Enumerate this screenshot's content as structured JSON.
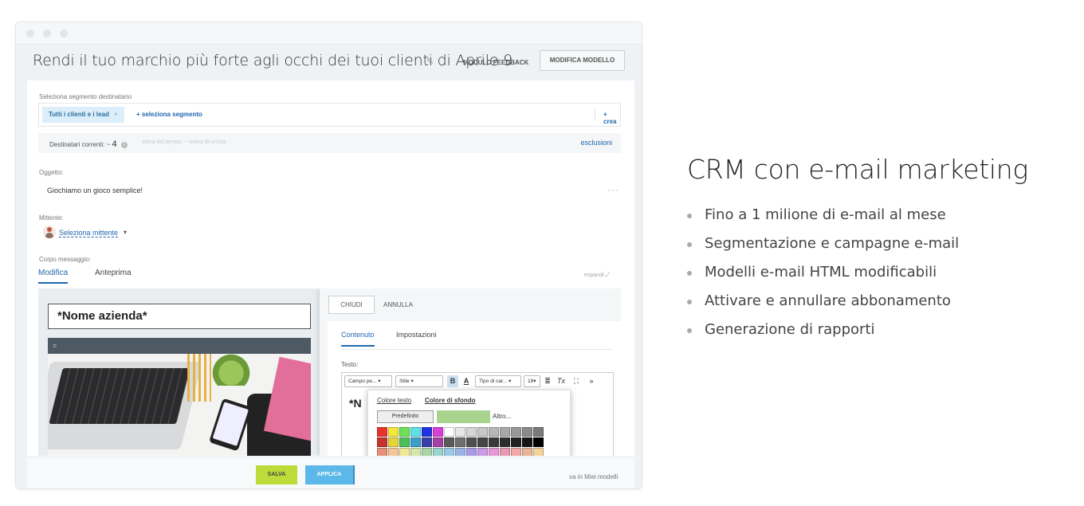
{
  "header": {
    "title": "Rendi il tuo marchio più forte agli occhi dei tuoi clienti di Aprile 9",
    "feedback_label": "MODULO FEEDBACK",
    "modello_label": "MODIFICA MODELLO"
  },
  "segment": {
    "label": "Seleziona segmento destinatario",
    "chip": "Tutti i clienti e i lead",
    "chip_remove": "×",
    "add": "+ seleziona segmento",
    "create": "+ crea",
    "recipients_label": "Destinatari correnti: ~",
    "recipients_count": "4",
    "time_estimate": "stima del tempo: ~ meno di un'ora",
    "exclusions": "esclusioni"
  },
  "subject": {
    "label": "Oggetto:",
    "value": "Giochiamo un gioco semplice!",
    "more": "···"
  },
  "sender": {
    "label": "Mittente:",
    "value": "Seleziona mittente",
    "caret": "▾"
  },
  "body": {
    "label": "Corpo messaggio:",
    "tabs": [
      "Modifica",
      "Anteprima"
    ],
    "expand": "espandi ⤢"
  },
  "email_preview": {
    "company_name": "*Nome azienda*",
    "menu_icon": "≡"
  },
  "side_panel": {
    "close": "CHIUDI",
    "cancel": "ANNULLA",
    "tabs": [
      "Contenuto",
      "Impostazioni"
    ],
    "text_label": "Testo:",
    "toolbar": {
      "field": "Campo pe...",
      "style": "Stile",
      "bold": "B",
      "color": "A",
      "font": "Tipo di car...",
      "size": "18",
      "align": "≣",
      "clear": "Tx",
      "fullscreen": "⛶",
      "more": "»"
    },
    "preview_text": "*N"
  },
  "color_picker": {
    "tab_text": "Colore testo",
    "tab_bg": "Colore di sfondo",
    "default": "Predefinito",
    "more": "Altro...",
    "current": "#a8d48f",
    "rows": [
      [
        "#e8352b",
        "#f5e83a",
        "#6ee05a",
        "#5ce1e6",
        "#1f33e0",
        "#d93fd9",
        "#ffffff",
        "#e6e6e6",
        "#d6d6d6",
        "#c7c7c7",
        "#b8b8b8",
        "#a8a8a8",
        "#999999",
        "#8a8a8a",
        "#7a7a7a"
      ],
      [
        "#c4332c",
        "#e6d43a",
        "#4bbf5a",
        "#3aa0c9",
        "#3a3fa8",
        "#a83fa8",
        "#5a5a5a",
        "#6e6e6e",
        "#505050",
        "#454545",
        "#3a3a3a",
        "#2e2e2e",
        "#222222",
        "#151515",
        "#000000"
      ],
      [
        "#e6907a",
        "#f2c79a",
        "#f2e89a",
        "#d6e6a8",
        "#a8d4a8",
        "#9ad4c9",
        "#9ac9e6",
        "#9ab4e6",
        "#a89ae6",
        "#c99ae6",
        "#e69ad4",
        "#e69ab4",
        "#f2a8a8",
        "#e6b49a",
        "#f2d49a"
      ],
      [
        "#d9604a",
        "#e89a5a",
        "#e6d45a",
        "#b4d46e",
        "#6ec46e",
        "#5ab4a8",
        "#5aa8d9",
        "#5a7ed9",
        "#7e5ad9",
        "#a85ad9",
        "#d95ab4",
        "#d95a7e",
        "#e66e6e",
        "#d9845a",
        "#e6b45a"
      ],
      [
        "#c44030",
        "#d9702e",
        "#d9b42e",
        "#8ab43a",
        "#3aa03a",
        "#2e9080",
        "#2e80c4",
        "#2e50c4",
        "#502ec4",
        "#802ec4",
        "#c42e90",
        "#c42e50",
        "#d94040",
        "#c45a2e",
        "#d9902e"
      ]
    ]
  },
  "actions": {
    "save": "SALVA",
    "apply": "APPLICA",
    "my_templates": "va in Miei modelli"
  },
  "promo": {
    "title": "CRM con e-mail marketing",
    "features": [
      "Fino a 1 milione di e-mail al mese",
      "Segmentazione e campagne e-mail",
      "Modelli e-mail HTML modificabili",
      "Attivare e annullare abbonamento",
      "Generazione di rapporti"
    ]
  }
}
